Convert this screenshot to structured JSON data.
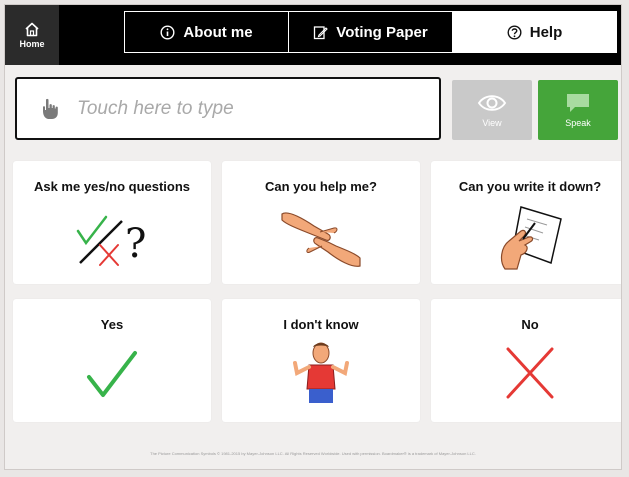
{
  "header": {
    "home_label": "Home",
    "tabs": [
      {
        "label": "About me",
        "icon": "info-icon"
      },
      {
        "label": "Voting Paper",
        "icon": "edit-document-icon"
      },
      {
        "label": "Help",
        "icon": "question-icon",
        "active": true
      }
    ]
  },
  "input": {
    "placeholder": "Touch here to type",
    "view_label": "View",
    "speak_label": "Speak"
  },
  "cards": [
    {
      "label": "Ask me yes/no questions",
      "icon": "yes-no-question-icon"
    },
    {
      "label": "Can you help me?",
      "icon": "helping-hands-icon"
    },
    {
      "label": "Can you write it down?",
      "icon": "writing-hand-icon"
    },
    {
      "label": "Yes",
      "icon": "green-check-icon"
    },
    {
      "label": "I don't know",
      "icon": "shrugging-person-icon"
    },
    {
      "label": "No",
      "icon": "red-cross-icon"
    }
  ],
  "footer": {
    "text": "The Picture Communication Symbols © 1981-2015 by Mayer-Johnson LLC. All Rights Reserved Worldwide. Used with permission. Boardmaker® is a trademark of Mayer-Johnson LLC."
  },
  "colors": {
    "speak_green": "#45a53a",
    "view_gray": "#c9c9c9",
    "check_green": "#37b34a",
    "cross_red": "#e53935"
  }
}
